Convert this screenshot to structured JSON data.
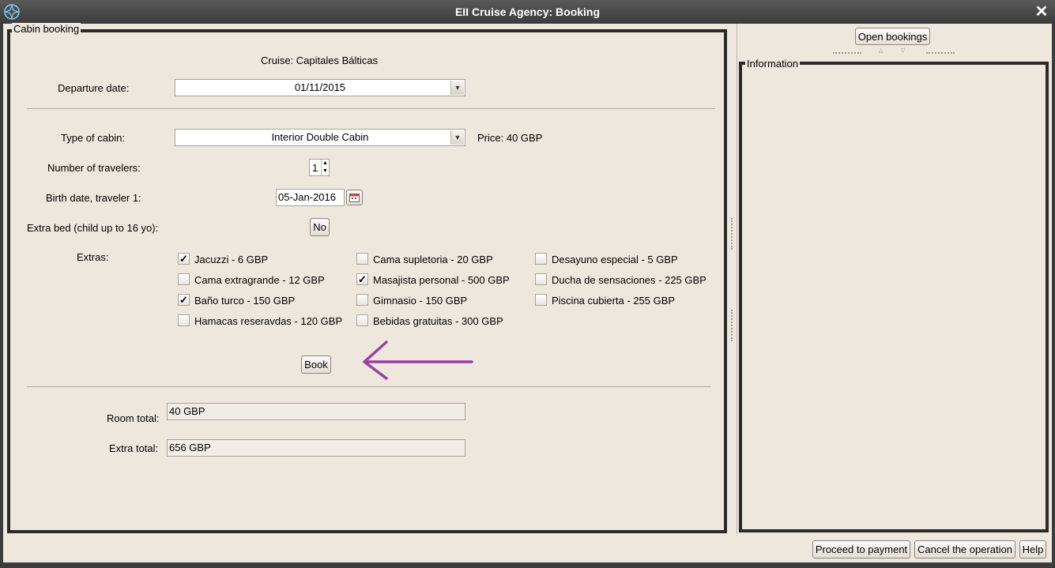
{
  "window": {
    "title": "EII Cruise Agency: Booking",
    "close_glyph": "✕"
  },
  "booking": {
    "group_label": "Cabin booking",
    "cruise_text": "Cruise: Capitales Bálticas",
    "departure_label": "Departure date:",
    "departure_value": "01/11/2015",
    "cabin_label": "Type of cabin:",
    "cabin_value": "Interior Double Cabin",
    "price_text": "Price: 40 GBP",
    "travelers_label": "Number of travelers:",
    "travelers_value": "1",
    "birth_label": "Birth date, traveler 1:",
    "birth_value": "05-Jan-2016",
    "extrabed_label": "Extra bed (child up to 16 yo):",
    "extrabed_value": "No",
    "extras_label": "Extras:",
    "extras": [
      {
        "label": "Jacuzzi - 6 GBP",
        "checked": true
      },
      {
        "label": "Cama supletoria - 20 GBP",
        "checked": false
      },
      {
        "label": "Desayuno especial - 5 GBP",
        "checked": false
      },
      {
        "label": "Cama extragrande - 12 GBP",
        "checked": false
      },
      {
        "label": "Masajista personal - 500 GBP",
        "checked": true
      },
      {
        "label": "Ducha de sensaciones - 225 GBP",
        "checked": false
      },
      {
        "label": "Baño turco - 150 GBP",
        "checked": true
      },
      {
        "label": "Gimnasio - 150 GBP",
        "checked": false
      },
      {
        "label": "Piscina cubierta - 255 GBP",
        "checked": false
      },
      {
        "label": "Hamacas reseravdas - 120 GBP",
        "checked": false
      },
      {
        "label": "Bebidas gratuitas - 300 GBP",
        "checked": false
      }
    ],
    "book_label": "Book",
    "room_total_label": "Room total:",
    "room_total_value": "40 GBP",
    "extra_total_label": "Extra total:",
    "extra_total_value": "656 GBP"
  },
  "sidebar": {
    "open_bookings_label": "Open bookings",
    "info_label": "Information"
  },
  "footer": {
    "proceed_label": "Proceed to payment",
    "cancel_label": "Cancel the operation",
    "help_label": "Help"
  },
  "annotation_color": "#9b3fa3"
}
